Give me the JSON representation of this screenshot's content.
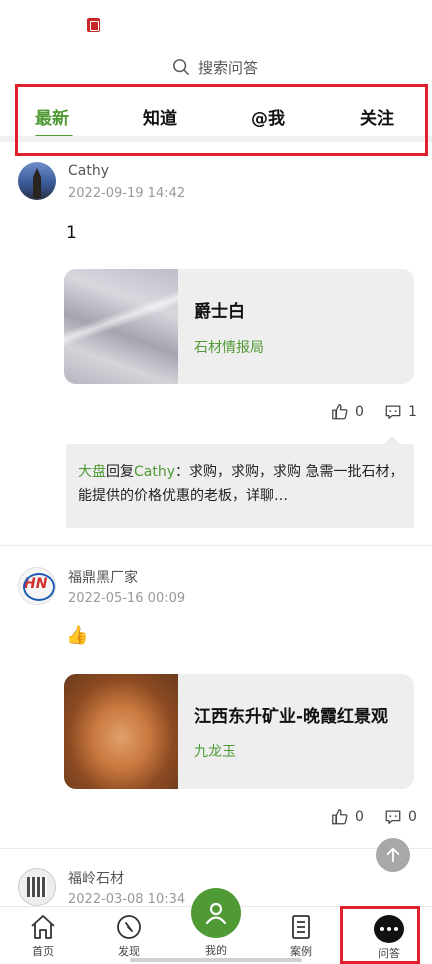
{
  "search": {
    "placeholder": "搜索问答"
  },
  "tabs": [
    {
      "label": "最新",
      "active": true
    },
    {
      "label": "知道",
      "active": false
    },
    {
      "label": "@我",
      "active": false
    },
    {
      "label": "关注",
      "active": false
    }
  ],
  "posts": [
    {
      "author": "Cathy",
      "time": "2022-09-19 14:42",
      "text": "1",
      "card": {
        "title": "爵士白",
        "subtitle": "石材情报局"
      },
      "likes": "0",
      "comments": "1",
      "reply": {
        "from": "大盘",
        "verb": "回复",
        "to": "Cathy",
        "text": "：求购，求购，求购 急需一批石材，能提供的价格优惠的老板，详聊…"
      }
    },
    {
      "author": "福鼎黑厂家",
      "time": "2022-05-16 00:09",
      "text": "👍",
      "card": {
        "title": "江西东升矿业-晚霞红景观",
        "subtitle": "九龙玉"
      },
      "likes": "0",
      "comments": "0"
    },
    {
      "author": "福岭石材",
      "time": "2022-03-08 10:34"
    }
  ],
  "bottom_nav": [
    {
      "label": "首页",
      "icon": "home-icon"
    },
    {
      "label": "发现",
      "icon": "compass-icon"
    },
    {
      "label": "我的",
      "icon": "user-icon"
    },
    {
      "label": "案例",
      "icon": "document-icon"
    },
    {
      "label": "问答",
      "icon": "chat-icon"
    }
  ],
  "colors": {
    "accent": "#4f9a34",
    "highlight": "#e0202a"
  }
}
